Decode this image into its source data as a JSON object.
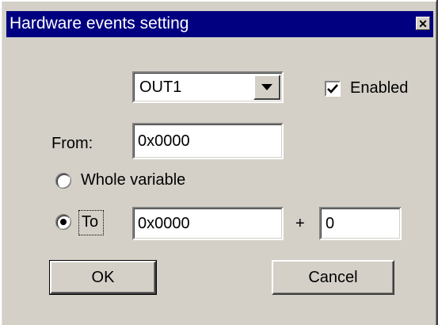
{
  "window": {
    "title": "Hardware events setting",
    "close_glyph": "✕"
  },
  "event_select": {
    "value": "OUT1",
    "icon": "chevron-down-icon"
  },
  "enabled": {
    "label": "Enabled",
    "checked": true
  },
  "from": {
    "label": "From:",
    "value": "0x0000"
  },
  "range_mode": {
    "whole_variable_label": "Whole variable",
    "to_label": "To",
    "selected": "To"
  },
  "to": {
    "value": "0x0000",
    "plus_label": "+",
    "offset_value": "0"
  },
  "buttons": {
    "ok_label": "OK",
    "cancel_label": "Cancel"
  },
  "colors": {
    "titlebar": "#000080",
    "face": "#d4d0c8"
  }
}
